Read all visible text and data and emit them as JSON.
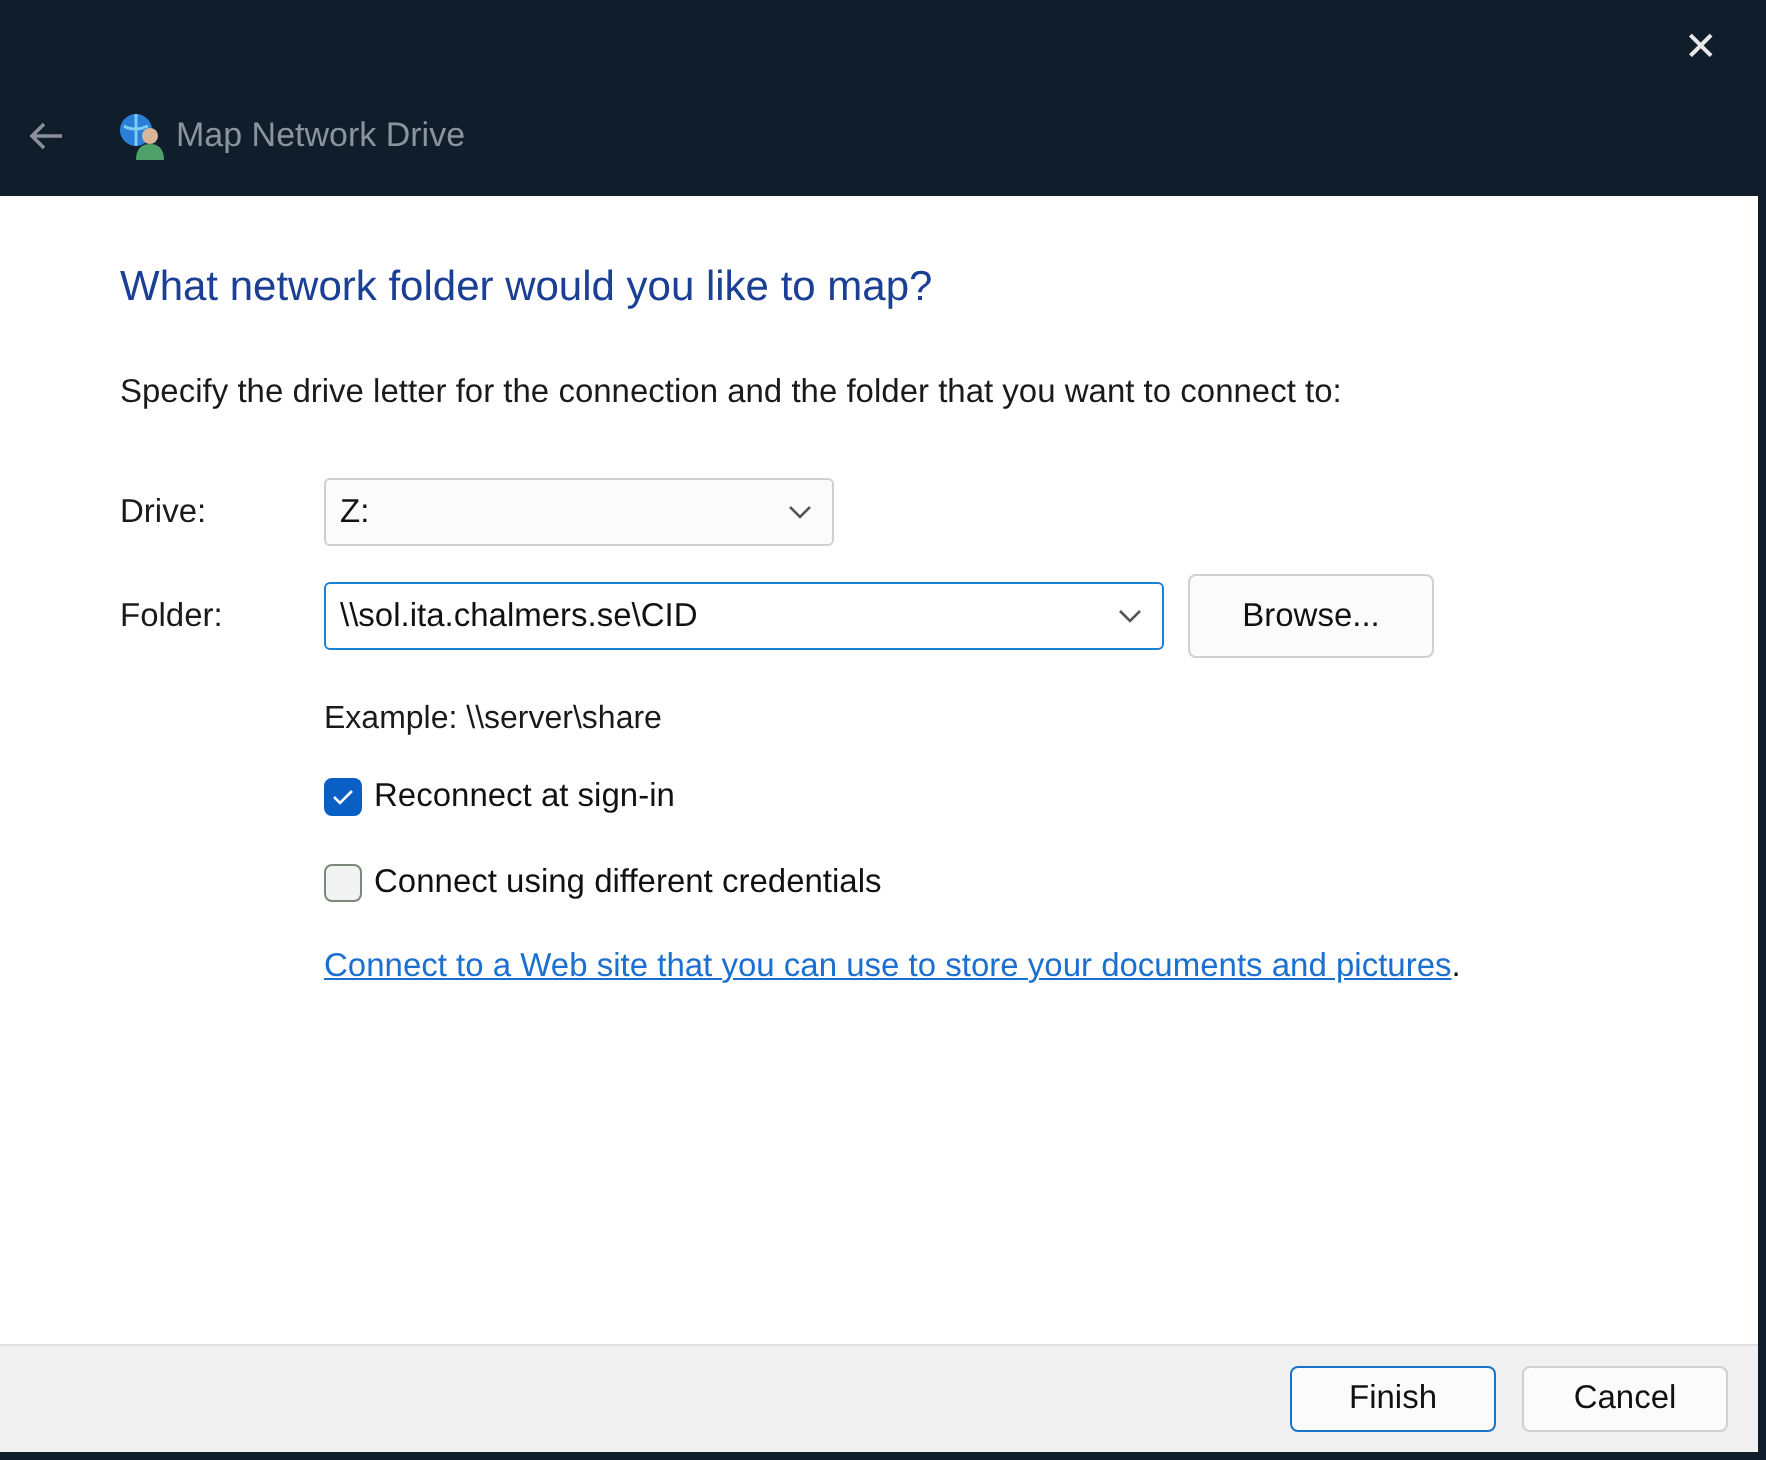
{
  "window": {
    "title": "Map Network Drive",
    "close": "✕"
  },
  "heading": "What network folder would you like to map?",
  "instructions": "Specify the drive letter for the connection and the folder that you want to connect to:",
  "drive": {
    "label": "Drive:",
    "value": "Z:"
  },
  "folder": {
    "label": "Folder:",
    "value": "\\\\sol.ita.chalmers.se\\CID",
    "browse": "Browse..."
  },
  "example": "Example: \\\\server\\share",
  "options": [
    {
      "label": "Reconnect at sign-in",
      "checked": true
    },
    {
      "label": "Connect using different credentials",
      "checked": false
    }
  ],
  "link": {
    "text": "Connect to a Web site that you can use to store your documents and pictures",
    "after": "."
  },
  "buttons": [
    {
      "label": "Finish",
      "selected": true
    },
    {
      "label": "Cancel",
      "selected": false
    }
  ]
}
